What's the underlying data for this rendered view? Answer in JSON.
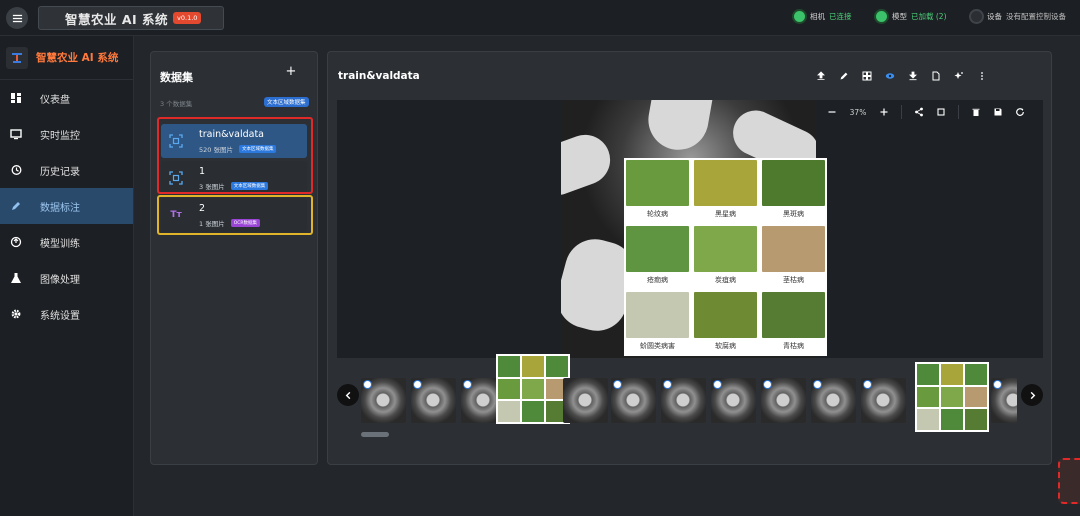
{
  "header": {
    "title": "智慧农业 AI 系统",
    "version": "v0.1.0",
    "camera": {
      "label": "相机",
      "value": "已连接"
    },
    "model": {
      "label": "模型",
      "value": "已加载 (2)"
    },
    "device": {
      "label": "设备",
      "value": "没有配置控制设备"
    }
  },
  "sidebar": {
    "brand": "智慧农业 AI 系统",
    "items": [
      {
        "label": "仪表盘",
        "icon": "dashboard-icon"
      },
      {
        "label": "实时监控",
        "icon": "monitor-icon"
      },
      {
        "label": "历史记录",
        "icon": "history-icon"
      },
      {
        "label": "数据标注",
        "icon": "pencil-icon"
      },
      {
        "label": "模型训练",
        "icon": "training-icon"
      },
      {
        "label": "图像处理",
        "icon": "flask-icon"
      },
      {
        "label": "系统设置",
        "icon": "gear-icon"
      }
    ],
    "active_index": 3
  },
  "datasets": {
    "title": "数据集",
    "count_text": "3 个数据集",
    "count_badge": "文本区域数据集",
    "items": [
      {
        "name": "train&valdata",
        "meta": "520 张图片",
        "badge": "文本区域数据集"
      },
      {
        "name": "1",
        "meta": "3 张图片",
        "badge": "文本区域数据集"
      },
      {
        "name": "2",
        "meta": "1 张图片",
        "badge": "OCR数据集"
      }
    ]
  },
  "viewer": {
    "title": "train&valdata",
    "zoom": "37%",
    "grid_labels": [
      "轮纹病",
      "黑星病",
      "黑斑病",
      "疮痂病",
      "炭疽病",
      "茎枯病",
      "蚧圆类病害",
      "软腐病",
      "青枯病"
    ]
  },
  "colors": {
    "accent": "#2f5786",
    "brand": "#ff7a3c",
    "ok": "#4bd17a"
  }
}
